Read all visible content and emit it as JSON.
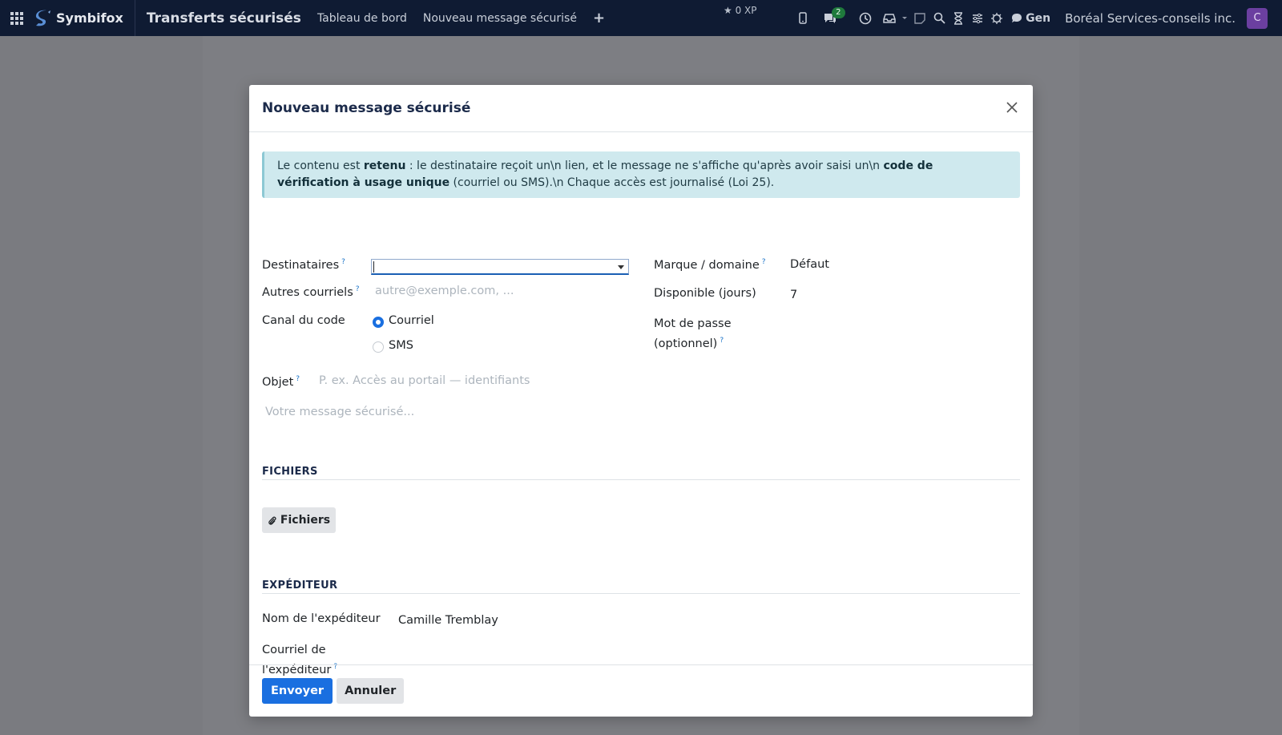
{
  "navbar": {
    "brand": "Symbifox",
    "app_title": "Transferts sécurisés",
    "links": [
      "Tableau de bord",
      "Nouveau message sécurisé"
    ],
    "plus": "+",
    "xp": "0 XP",
    "chat_badge": "2",
    "gen_label": "Gen",
    "company": "Boréal Services-conseils inc.",
    "avatar_initial": "C"
  },
  "modal": {
    "title": "Nouveau message sécurisé",
    "alert": {
      "t1": "Le contenu est ",
      "b1": "retenu",
      "t2": " : le destinataire reçoit un\\n lien, et le message ne s'affiche qu'après avoir saisi un\\n ",
      "b2": "code de vérification à usage unique",
      "t3": " (courriel ou SMS).\\n Chaque accès est journalisé (Loi 25)."
    },
    "fields": {
      "recipients_label": "Destinataires",
      "other_emails_label": "Autres courriels",
      "other_emails_placeholder": "autre@exemple.com, ...",
      "code_channel_label": "Canal du code",
      "channel_options": [
        "Courriel",
        "SMS"
      ],
      "channel_selected": "Courriel",
      "brand_label": "Marque / domaine",
      "brand_value": "Défaut",
      "available_label": "Disponible (jours)",
      "available_value": "7",
      "password_label_1": "Mot de passe",
      "password_label_2": "(optionnel)",
      "subject_label": "Objet",
      "subject_placeholder": "P. ex. Accès au portail — identifiants",
      "message_placeholder": "Votre message sécurisé..."
    },
    "files_section": {
      "title": "FICHIERS",
      "button": "Fichiers"
    },
    "sender_section": {
      "title": "EXPÉDITEUR",
      "name_label": "Nom de l'expéditeur",
      "name_value": "Camille Tremblay",
      "email_label_1": "Courriel de",
      "email_label_2": "l'expéditeur"
    },
    "footer": {
      "send": "Envoyer",
      "cancel": "Annuler"
    },
    "help_mark": "?"
  },
  "colors": {
    "navbar_bg": "#0f1b33",
    "primary": "#1a6fe0",
    "alert_bg": "#cfe9ee",
    "avatar_bg": "#6b3fa0"
  },
  "icons": [
    "apps-grid-icon",
    "mobile-icon",
    "chat-icon",
    "clock-icon",
    "inbox-icon",
    "note-icon",
    "search-icon",
    "hourglass-icon",
    "settings-sliders-icon",
    "bug-icon",
    "close-icon",
    "paperclip-icon",
    "star-icon"
  ]
}
